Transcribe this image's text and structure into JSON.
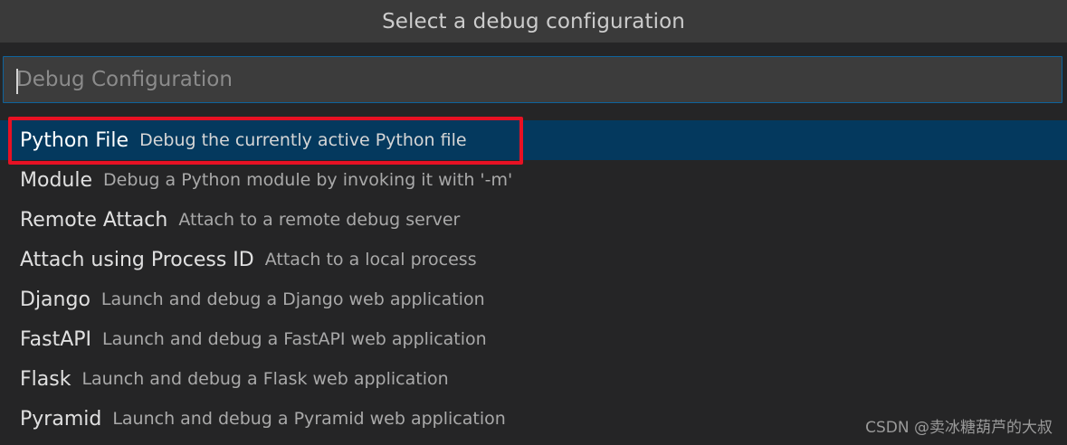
{
  "title": "Select a debug configuration",
  "input": {
    "placeholder": "Debug Configuration",
    "value": ""
  },
  "items": [
    {
      "label": "Python File",
      "description": "Debug the currently active Python file",
      "selected": true
    },
    {
      "label": "Module",
      "description": "Debug a Python module by invoking it with '-m'",
      "selected": false
    },
    {
      "label": "Remote Attach",
      "description": "Attach to a remote debug server",
      "selected": false
    },
    {
      "label": "Attach using Process ID",
      "description": "Attach to a local process",
      "selected": false
    },
    {
      "label": "Django",
      "description": "Launch and debug a Django web application",
      "selected": false
    },
    {
      "label": "FastAPI",
      "description": "Launch and debug a FastAPI web application",
      "selected": false
    },
    {
      "label": "Flask",
      "description": "Launch and debug a Flask web application",
      "selected": false
    },
    {
      "label": "Pyramid",
      "description": "Launch and debug a Pyramid web application",
      "selected": false
    }
  ],
  "watermark": "CSDN @卖冰糖葫芦的大叔",
  "colors": {
    "background": "#252526",
    "title_bar": "#3a3a3a",
    "input_border": "#0e639c",
    "selected_row": "#04395e",
    "annotation_box": "#e81123"
  }
}
